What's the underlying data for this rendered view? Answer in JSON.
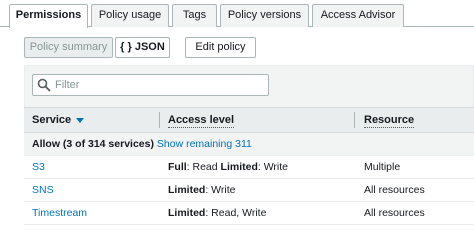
{
  "tabs": [
    {
      "label": "Permissions"
    },
    {
      "label": "Policy usage"
    },
    {
      "label": "Tags"
    },
    {
      "label": "Policy versions"
    },
    {
      "label": "Access Advisor"
    }
  ],
  "toolbar": {
    "policy_summary": "Policy summary",
    "json": "{ } JSON",
    "edit_policy": "Edit policy"
  },
  "filter": {
    "placeholder": "Filter"
  },
  "table": {
    "headers": {
      "service": "Service",
      "access_level": "Access level",
      "resource": "Resource"
    },
    "group": {
      "label": "Allow (3 of 314 services)",
      "link": "Show remaining 311"
    },
    "rows": [
      {
        "service": "S3",
        "access": [
          {
            "level": "Full",
            "detail": ": Read "
          },
          {
            "level": "Limited",
            "detail": ": Write"
          }
        ],
        "resource": "Multiple"
      },
      {
        "service": "SNS",
        "access": [
          {
            "level": "Limited",
            "detail": ": Write"
          }
        ],
        "resource": "All resources"
      },
      {
        "service": "Timestream",
        "access": [
          {
            "level": "Limited",
            "detail": ": Read, Write"
          }
        ],
        "resource": "All resources"
      }
    ]
  },
  "colors": {
    "link": "#0073bb",
    "header_bg": "#eaeded",
    "border": "#aab7b8"
  }
}
